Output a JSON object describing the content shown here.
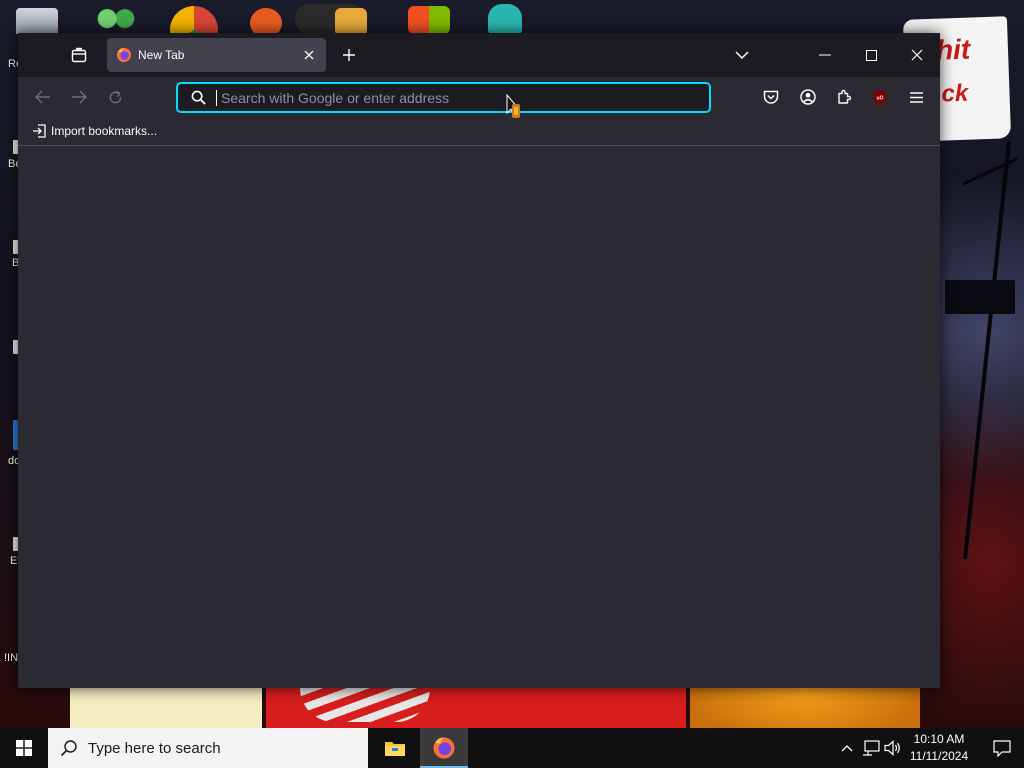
{
  "desktop": {
    "icon_labels": [
      "Re",
      "Be",
      "B",
      "do",
      "Ev",
      "!IN"
    ],
    "sticker_lines": [
      "hit",
      "ck"
    ]
  },
  "browser": {
    "tab": {
      "title": "New Tab"
    },
    "urlbar": {
      "placeholder": "Search with Google or enter address",
      "value": ""
    },
    "bookmarks": {
      "import_label": "Import bookmarks..."
    },
    "toolbar_icons": [
      "pocket-icon",
      "account-icon",
      "extensions-icon",
      "ublock-icon",
      "menu-icon"
    ],
    "colors": {
      "accent": "#00ddff",
      "chrome": "#1c1b22",
      "toolbar": "#2b2a33",
      "tab": "#42414d"
    }
  },
  "taskbar": {
    "search_placeholder": "Type here to search",
    "pinned": [
      "file-explorer-icon",
      "firefox-icon"
    ],
    "clock": {
      "time": "10:10 AM",
      "date": "11/11/2024"
    }
  }
}
